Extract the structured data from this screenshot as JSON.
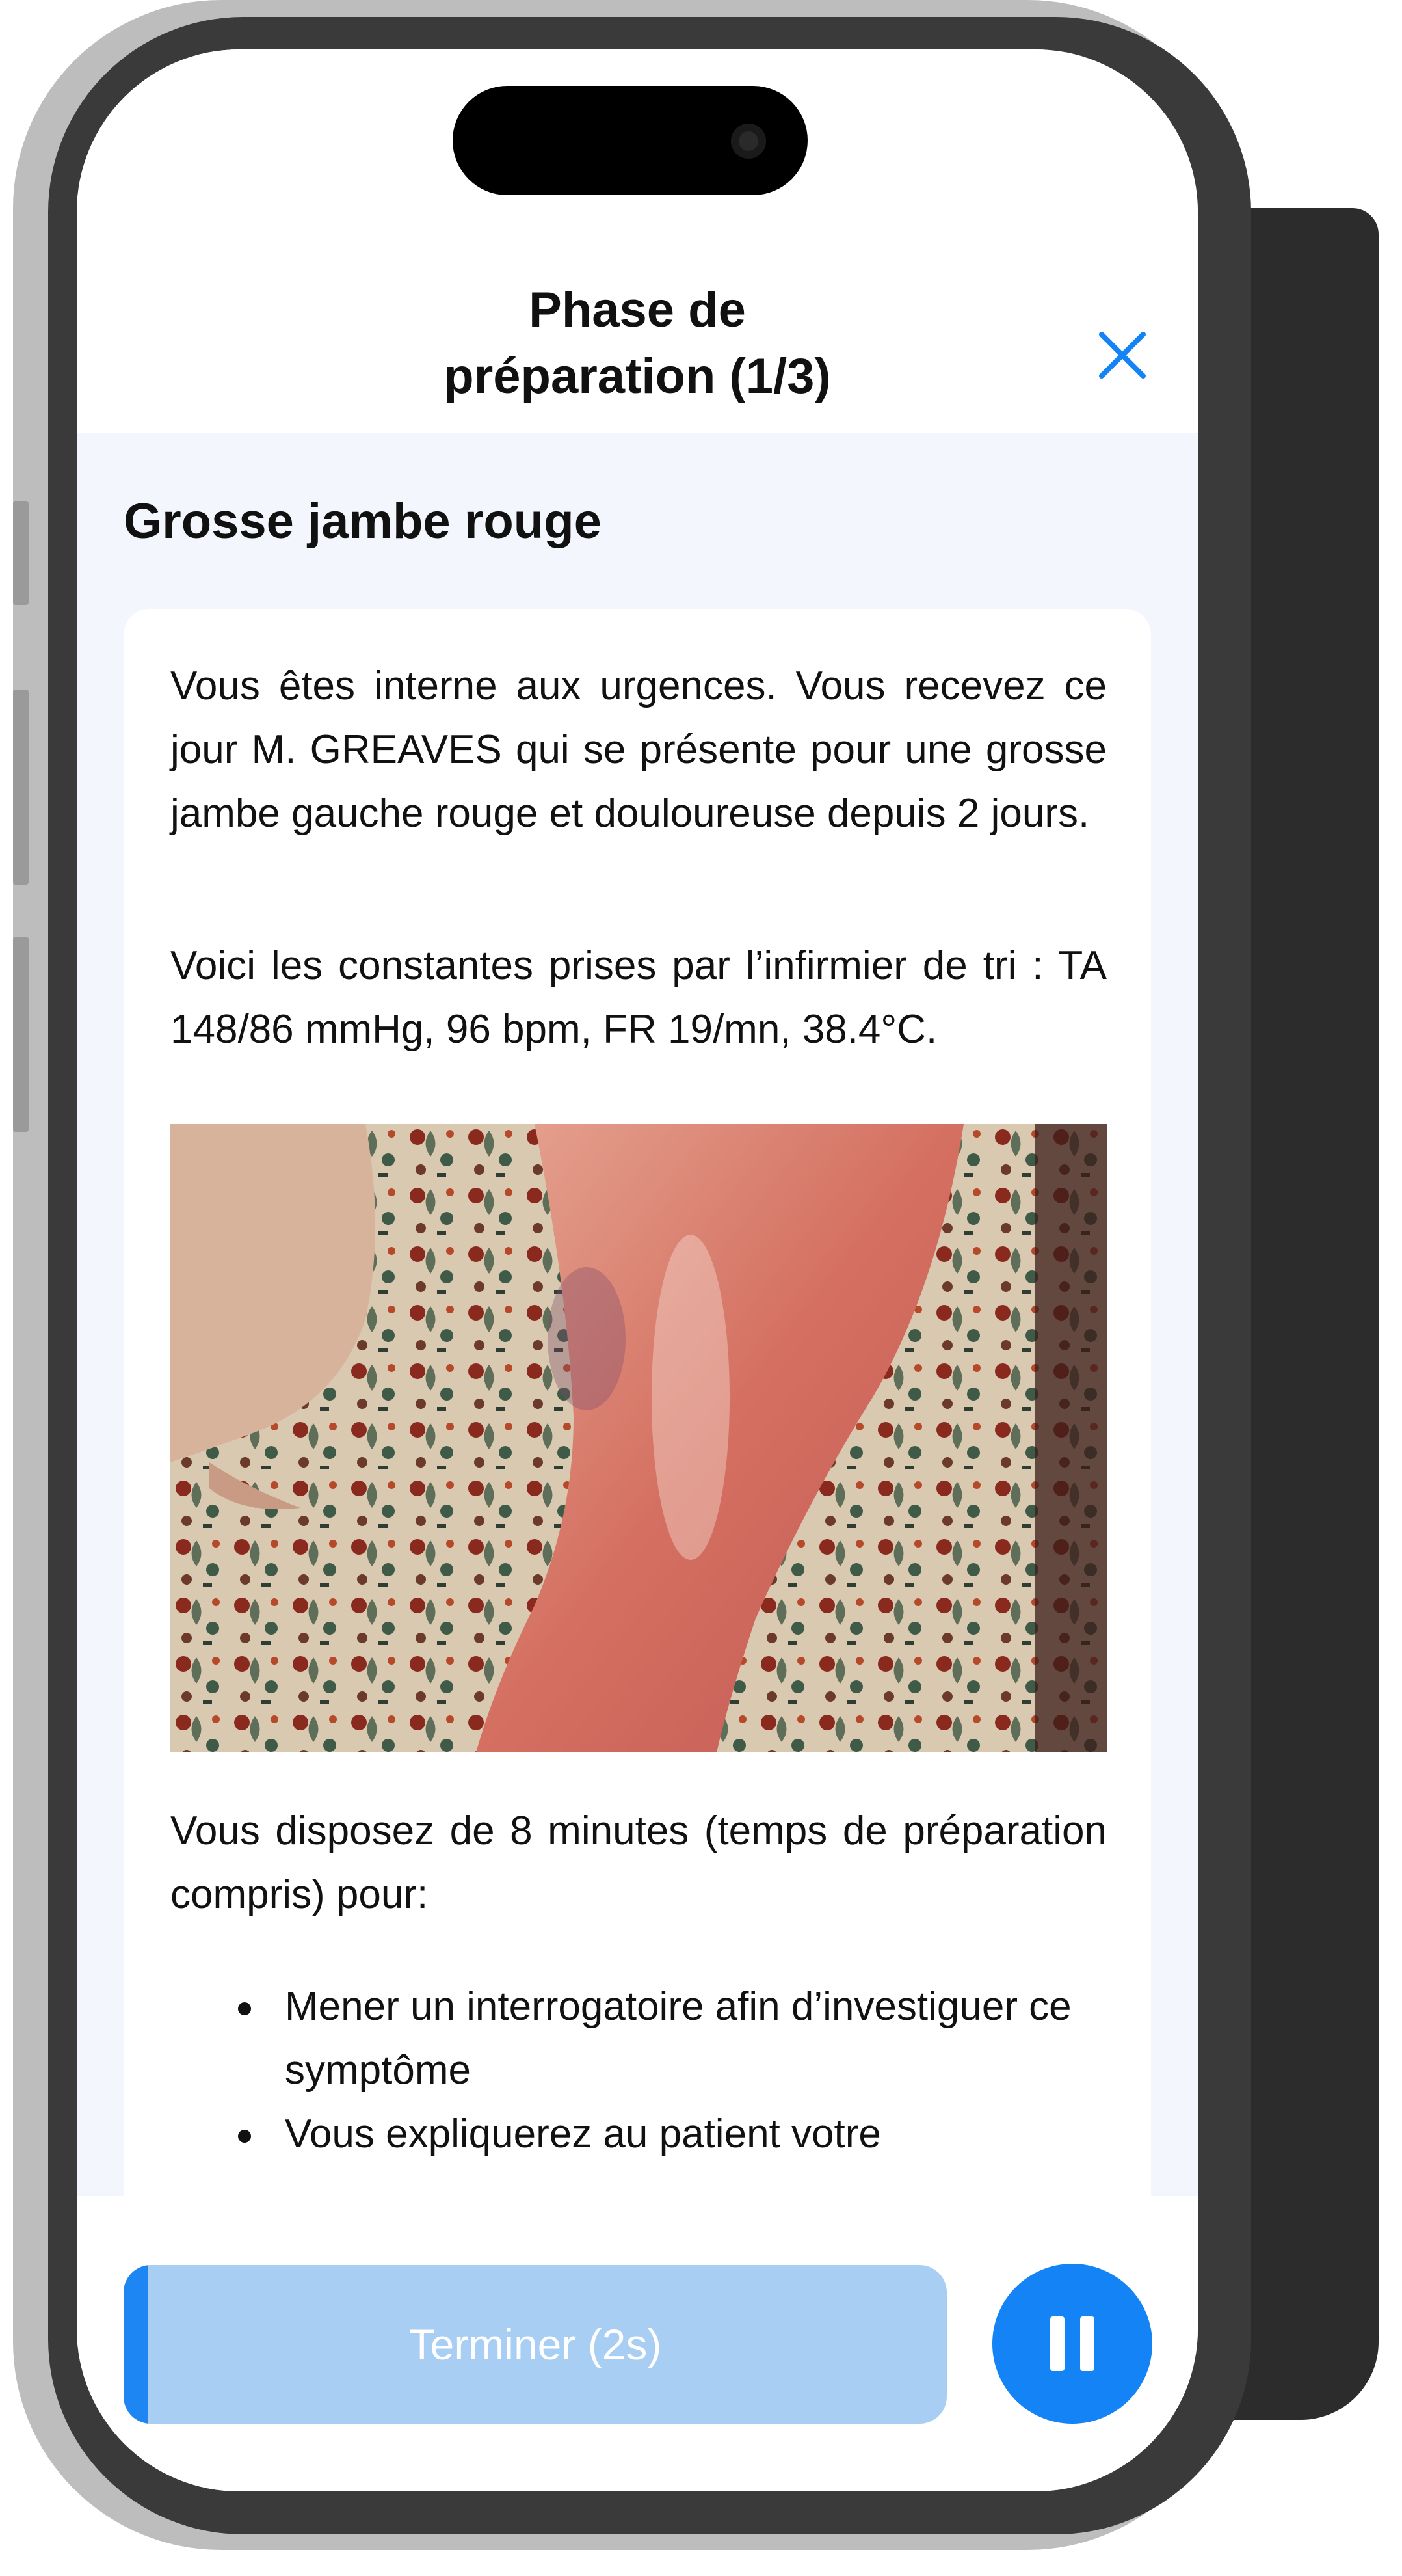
{
  "header": {
    "title": "Phase de préparation (1/3)",
    "close_icon": "close-icon"
  },
  "case": {
    "title": "Grosse jambe rouge",
    "intro": "Vous êtes interne aux urgences. Vous recevez ce jour M. GREAVES qui se présente pour une grosse jambe gauche rouge et douloureuse depuis 2 jours.",
    "vitals": "Voici les constantes prises par l’infirmier de tri : TA 148/86 mmHg, 96 bpm, FR 19/mn, 38.4°C.",
    "photo": "leg-photo",
    "instructions": "Vous disposez de 8 minutes (temps de préparation compris) pour:",
    "bullets": [
      "Mener un interrogatoire afin d’investiguer ce symptôme",
      "Vous expliquerez au patient votre"
    ]
  },
  "footer": {
    "finish_label": "Terminer (2s)",
    "finish_progress": 0.03,
    "pause_icon": "pause-icon"
  },
  "colors": {
    "accent": "#1383f5",
    "button_disabled": "#a9cef3",
    "content_bg": "#f3f7fd"
  }
}
